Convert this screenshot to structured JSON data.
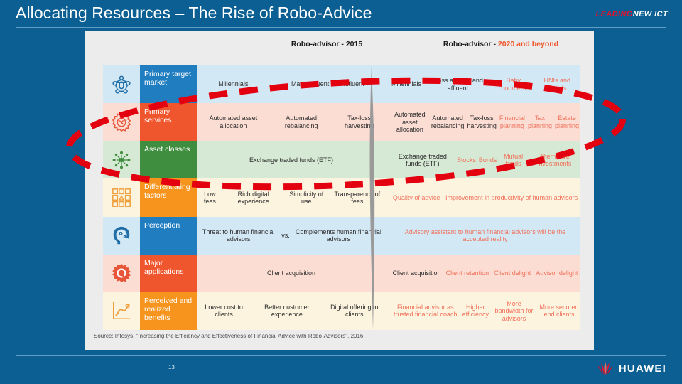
{
  "header": {
    "title": "Allocating Resources – The Rise of Robo-Advice",
    "brand_leading": "LEADING",
    "brand_newict": "NEW ICT"
  },
  "columns": {
    "left_prefix": "Robo-advisor - ",
    "left_period": "2015",
    "right_prefix": "Robo-advisor - ",
    "right_period": "2020 and beyond"
  },
  "rows": [
    {
      "label": "Primary target market",
      "icon": "network-people-icon",
      "label_color": "#1f7dc0",
      "bg_color": "#d3e8f5",
      "icon_color": "#1f6ea8",
      "left_cells": [
        {
          "text": "Millennials",
          "muted": false
        },
        {
          "text": "Mass affluent and affluent",
          "muted": false
        }
      ],
      "right_cells": [
        {
          "text": "Millennials",
          "muted": false
        },
        {
          "text": "Mass affluent and affluent",
          "muted": false
        },
        {
          "text": "Baby boomers",
          "muted": true
        },
        {
          "text": "HNIs and UHNIs",
          "muted": true
        }
      ]
    },
    {
      "label": "Primary services",
      "icon": "gear-tools-icon",
      "label_color": "#f0562d",
      "bg_color": "#fbddd3",
      "icon_color": "#e8563a",
      "left_cells": [
        {
          "text": "Automated asset allocation",
          "muted": false
        },
        {
          "text": "Automated rebalancing",
          "muted": false
        },
        {
          "text": "Tax-loss harvesting",
          "muted": false
        }
      ],
      "right_cells": [
        {
          "text": "Automated asset allocation",
          "muted": false
        },
        {
          "text": "Automated rebalancing",
          "muted": false
        },
        {
          "text": "Tax-loss harvesting",
          "muted": false
        },
        {
          "text": "Financial planning",
          "muted": true
        },
        {
          "text": "Tax planning",
          "muted": true
        },
        {
          "text": "Estate planning",
          "muted": true
        }
      ]
    },
    {
      "label": "Asset classes",
      "icon": "asset-molecule-icon",
      "label_color": "#3f8d3f",
      "bg_color": "#d6e9d4",
      "icon_color": "#3f8d3f",
      "left_cells": [
        {
          "text": "Exchange traded funds (ETF)",
          "muted": false
        }
      ],
      "right_cells": [
        {
          "text": "Exchange traded funds (ETF)",
          "muted": false
        },
        {
          "text": "Stocks",
          "muted": true
        },
        {
          "text": "Bonds",
          "muted": true
        },
        {
          "text": "Mutual funds",
          "muted": true
        },
        {
          "text": "Alternative investments",
          "muted": true
        }
      ]
    },
    {
      "label": "Differentiating factors",
      "icon": "grid-blocks-icon",
      "label_color": "#f7941e",
      "bg_color": "#fdf4e0",
      "icon_color": "#f0a03c",
      "left_cells": [
        {
          "text": "Low fees",
          "muted": false
        },
        {
          "text": "Rich digital experience",
          "muted": false
        },
        {
          "text": "Simplicity of use",
          "muted": false
        },
        {
          "text": "Transparency of fees",
          "muted": false
        }
      ],
      "right_cells": [
        {
          "text": "Quality of advice",
          "muted": true
        },
        {
          "text": "Improvement in productivity of human advisors",
          "muted": true
        }
      ]
    },
    {
      "label": "Perception",
      "icon": "brain-gears-icon",
      "label_color": "#1f7dc0",
      "bg_color": "#d3e8f5",
      "icon_color": "#1f6ea8",
      "left_cells": [
        {
          "text": "Threat to human financial advisors",
          "muted": false
        },
        {
          "text": "vs.",
          "muted": false
        },
        {
          "text": "Complements human financial advisors",
          "muted": false
        }
      ],
      "right_cells": [
        {
          "text": "Advisory assistant to human financial advisors will be the accepted reality",
          "muted": true
        }
      ]
    },
    {
      "label": "Major applications",
      "icon": "gear-wrench-icon",
      "label_color": "#f0562d",
      "bg_color": "#fbddd3",
      "icon_color": "#e8563a",
      "left_cells": [
        {
          "text": "Client acquisition",
          "muted": false
        }
      ],
      "right_cells": [
        {
          "text": "Client acquisition",
          "muted": false
        },
        {
          "text": "Client retention",
          "muted": true
        },
        {
          "text": "Client delight",
          "muted": true
        },
        {
          "text": "Advisor delight",
          "muted": true
        }
      ]
    },
    {
      "label": "Perceived and realized benefits",
      "icon": "growth-chart-icon",
      "label_color": "#f7941e",
      "bg_color": "#fdf4e0",
      "icon_color": "#f0a03c",
      "left_cells": [
        {
          "text": "Lower cost to clients",
          "muted": false
        },
        {
          "text": "Better customer experience",
          "muted": false
        },
        {
          "text": "Digital offering to clients",
          "muted": false
        }
      ],
      "right_cells": [
        {
          "text": "Financial advisor as trusted financial coach",
          "muted": true
        },
        {
          "text": "Higher efficiency",
          "muted": true
        },
        {
          "text": "More bandwidth for advisors",
          "muted": true
        },
        {
          "text": "More secured end clients",
          "muted": true
        }
      ]
    }
  ],
  "source": "Source: Infosys, \"Increasing the Efficiency and Effectiveness of Financial Advice with Robo-Advisors\", 2016",
  "footer": {
    "page_number": "13",
    "logo_text": "HUAWEI"
  },
  "annotation": {
    "shape": "dashed-red-ellipse",
    "color": "#e3000f"
  },
  "theme": {
    "slide_bg": "#0b5f93",
    "card_bg": "#ececec",
    "accent_orange": "#f0562d",
    "accent_blue": "#1f7dc0",
    "accent_green": "#3f8d3f",
    "accent_amber": "#f7941e"
  }
}
